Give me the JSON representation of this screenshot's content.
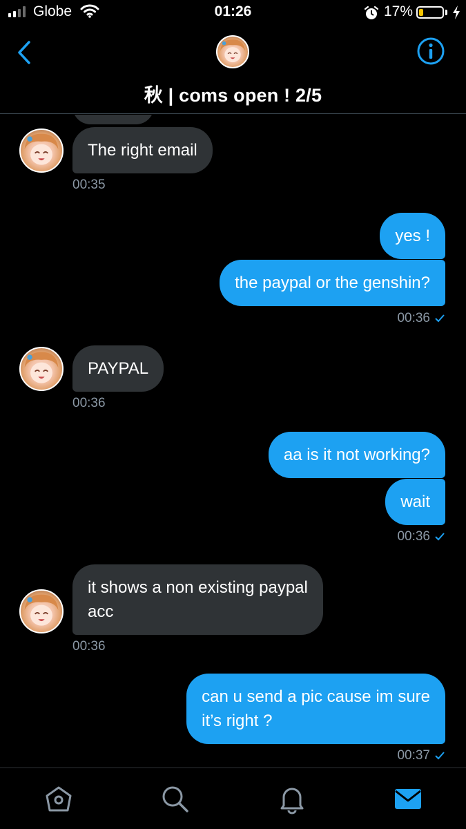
{
  "status_bar": {
    "carrier": "Globe",
    "time": "01:26",
    "battery_percent": "17%",
    "battery_level": 0.17,
    "signal_bars_filled": 2,
    "signal_bars_total": 4
  },
  "header": {
    "title": "秋 | coms open ! 2/5",
    "back_icon": "chevron-left-icon",
    "info_icon": "info-circle-icon"
  },
  "messages": [
    {
      "side": "received",
      "text": "The right email",
      "time": "00:35"
    },
    {
      "side": "sent",
      "text": "yes !"
    },
    {
      "side": "sent",
      "text": "the paypal or the genshin?",
      "time": "00:36"
    },
    {
      "side": "received",
      "text": "PAYPAL",
      "time": "00:36"
    },
    {
      "side": "sent",
      "text": "aa is it not working?"
    },
    {
      "side": "sent",
      "text": "wait",
      "time": "00:36"
    },
    {
      "side": "received",
      "text": "it shows a non existing paypal\nacc",
      "time": "00:36"
    },
    {
      "side": "sent",
      "text": "can u send a pic cause im sure\nit’s right ?",
      "time": "00:37"
    }
  ],
  "tab_bar": {
    "tabs": [
      "home-icon",
      "search-icon",
      "notifications-bell-icon",
      "messages-envelope-icon"
    ],
    "active": "messages-envelope-icon"
  },
  "colors": {
    "background": "#000000",
    "accent": "#1da1f2",
    "received_bubble": "#2f3336",
    "timestamp": "#8b98a5",
    "battery_fill": "#f5c400"
  }
}
